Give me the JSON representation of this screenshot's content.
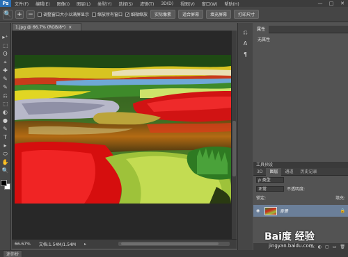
{
  "app": {
    "logo": "Ps"
  },
  "menu": [
    "文件(F)",
    "编辑(E)",
    "图像(I)",
    "图层(L)",
    "类型(Y)",
    "选择(S)",
    "滤镜(T)",
    "3D(D)",
    "视图(V)",
    "窗口(W)",
    "帮助(H)"
  ],
  "window_buttons": [
    "—",
    "□",
    "✕"
  ],
  "options_bar": {
    "checkbox_resize": "调整窗口大小以满屏显示",
    "checkbox_zoom_all": "缩放所有窗口",
    "checkbox_scrubby": "细微缩放",
    "scrubby_checked": true,
    "btn_actual_pixels": "实际像素",
    "btn_fit_screen": "适合屏幕",
    "btn_fill_screen": "填充屏幕",
    "btn_print_size": "打印尺寸"
  },
  "document": {
    "tab_title": "1.jpg @ 66.7% (RGB/8*)",
    "tab_close": "×"
  },
  "status": {
    "zoom": "66.67%",
    "doc_info": "文档:1.54M/1.54M",
    "arrow": "▸"
  },
  "bottom_tab": "迷你桥",
  "panels": {
    "properties": {
      "tab": "属性",
      "message": "无属性"
    },
    "tools_presets_title": "工具预设",
    "layers_tabs": [
      "3D",
      "图层",
      "通道",
      "历史记录"
    ],
    "kind_label": "ρ 类型",
    "blend_mode": "正常",
    "opacity_label": "不透明度:",
    "lock_label": "锁定:",
    "fill_label": "填充:",
    "layer_name": "背景",
    "footer_icons": [
      "fx",
      "◐",
      "▢",
      "▭",
      "🗑"
    ]
  },
  "toolbar_icons": [
    "▸⁺",
    "⬚",
    "ʘ",
    "⌖",
    "✚",
    "✎",
    "✎",
    "⎌",
    "⬚",
    "◐",
    "●",
    "✎",
    "T",
    "▸",
    "⬭",
    "✋",
    "🔍"
  ],
  "watermark": {
    "brand": "Bai度 经验",
    "url": "jingyan.baidu.com"
  }
}
